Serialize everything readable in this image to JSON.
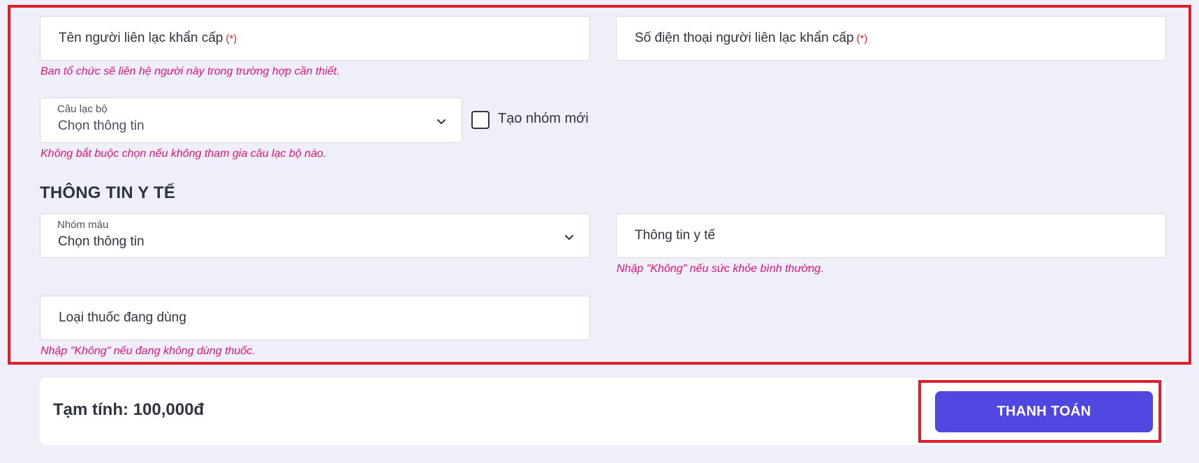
{
  "emergency": {
    "name_placeholder": "Tên người liên lạc khẩn cấp",
    "phone_placeholder": "Số điện thoại người liên lạc khẩn cấp",
    "required_mark": "(*)",
    "hint": "Ban tổ chức sẽ liên hệ người này trong trường hợp cần thiết."
  },
  "club": {
    "label": "Câu lạc bộ",
    "value": "Chọn thông tin",
    "hint": "Không bắt buộc chọn nếu không tham gia câu lạc bộ nào.",
    "new_group_label": "Tạo nhóm mới",
    "new_group_checked": false
  },
  "medical": {
    "section_title": "THÔNG TIN Y TẾ",
    "blood_label": "Nhóm máu",
    "blood_value": "Chọn thông tin",
    "medical_info_placeholder": "Thông tin y tế",
    "medical_info_hint": "Nhập \"Không\" nếu sức khỏe bình thường.",
    "medication_placeholder": "Loại thuốc đang dùng",
    "medication_hint": "Nhập \"Không\" nếu đang không dùng thuốc."
  },
  "footer": {
    "subtotal": "Tạm tính: 100,000đ",
    "pay_label": "THANH TOÁN"
  },
  "colors": {
    "accent": "#5046e0",
    "hint": "#e3127a",
    "highlight": "#e01e2b",
    "background": "#eeeff8"
  }
}
